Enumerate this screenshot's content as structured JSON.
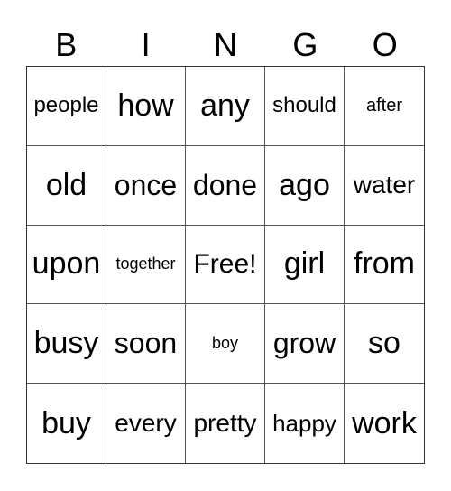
{
  "header": [
    "B",
    "I",
    "N",
    "G",
    "O"
  ],
  "cells": [
    "people",
    "how",
    "any",
    "should",
    "after",
    "old",
    "once",
    "done",
    "ago",
    "water",
    "upon",
    "together",
    "Free!",
    "girl",
    "from",
    "busy",
    "soon",
    "boy",
    "grow",
    "so",
    "buy",
    "every",
    "pretty",
    "happy",
    "work"
  ]
}
